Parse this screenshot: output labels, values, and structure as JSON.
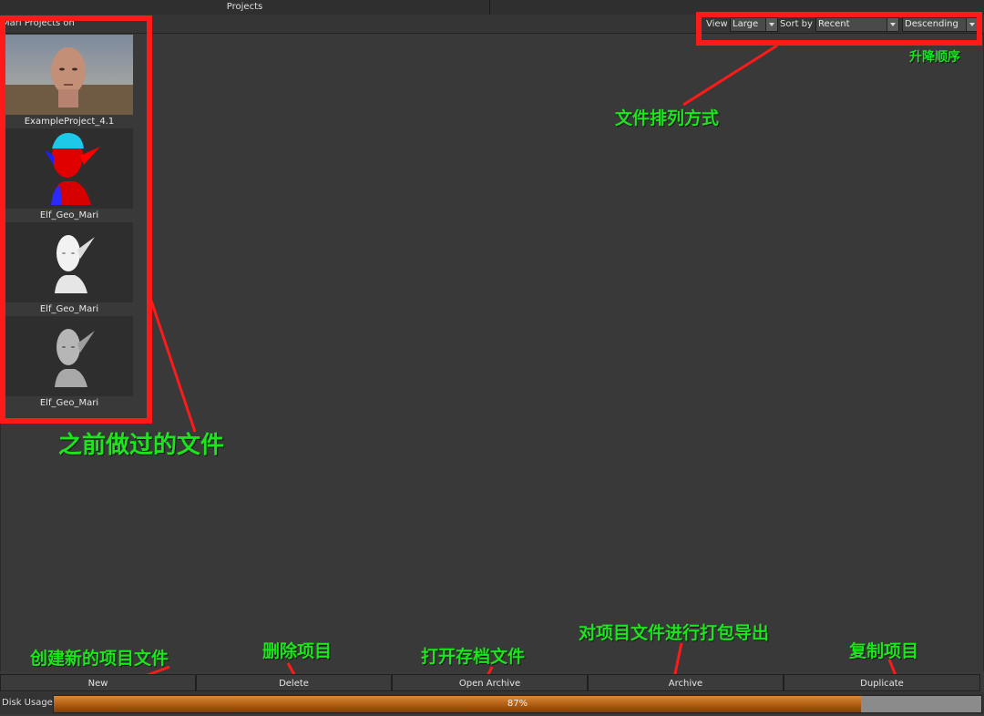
{
  "window": {
    "tab_title": "Projects",
    "header_label": "Mari Projects on"
  },
  "sort_controls": {
    "view_label": "View",
    "view_value": "Large",
    "sort_label": "Sort by",
    "sort_value": "Recent",
    "order_value": "Descending"
  },
  "projects": [
    {
      "name": "ExampleProject_4.1",
      "thumb": "bald-head-icon"
    },
    {
      "name": "Elf_Geo_Mari",
      "thumb": "elf-bust-colored-icon"
    },
    {
      "name": "Elf_Geo_Mari",
      "thumb": "elf-bust-white-icon"
    },
    {
      "name": "Elf_Geo_Mari",
      "thumb": "elf-bust-grey-icon"
    }
  ],
  "buttons": {
    "new": "New",
    "delete": "Delete",
    "open_archive": "Open Archive",
    "archive": "Archive",
    "duplicate": "Duplicate"
  },
  "disk": {
    "label": "Disk Usage",
    "percent_text": "87%",
    "fraction": 0.87
  },
  "annotations": {
    "order": "升降顺序",
    "sort_mode": "文件排列方式",
    "previous_files": "之前做过的文件",
    "new": "创建新的项目文件",
    "delete": "删除项目",
    "open_archive": "打开存档文件",
    "archive": "对项目文件进行打包导出",
    "duplicate": "复制项目"
  },
  "colors": {
    "annotation_text": "#1be51b",
    "highlight_box": "#ff1a1a",
    "disk_fill": "#b45f14"
  }
}
